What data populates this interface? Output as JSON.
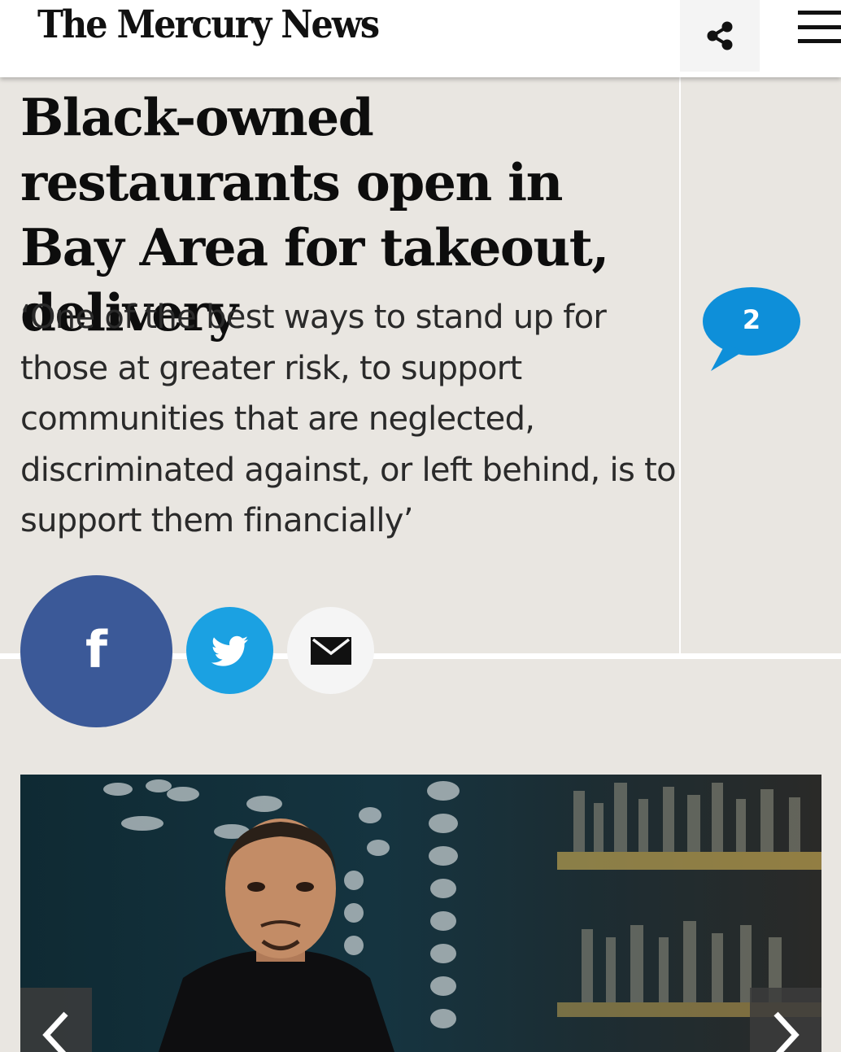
{
  "header": {
    "logo_text": "The Mercury News",
    "share_icon": "share-icon",
    "menu_icon": "hamburger-menu-icon"
  },
  "article": {
    "headline": "Black-owned restaurants open in Bay Area for takeout, delivery",
    "dek": "‘One of the best ways to stand up for those at greater risk, to support communities that are neglected, discriminated against, or left behind, is to support them financially’",
    "comment_count": "2"
  },
  "social": {
    "facebook_glyph": "f",
    "facebook_icon": "facebook-icon",
    "twitter_icon": "twitter-bird-icon",
    "email_icon": "envelope-icon"
  },
  "gallery": {
    "prev_icon": "chevron-left-icon",
    "next_icon": "chevron-right-icon"
  },
  "colors": {
    "page_bg": "#e9e6e1",
    "facebook": "#3b5998",
    "twitter": "#1ba1e2",
    "comment_bubble": "#0e8fd9"
  }
}
